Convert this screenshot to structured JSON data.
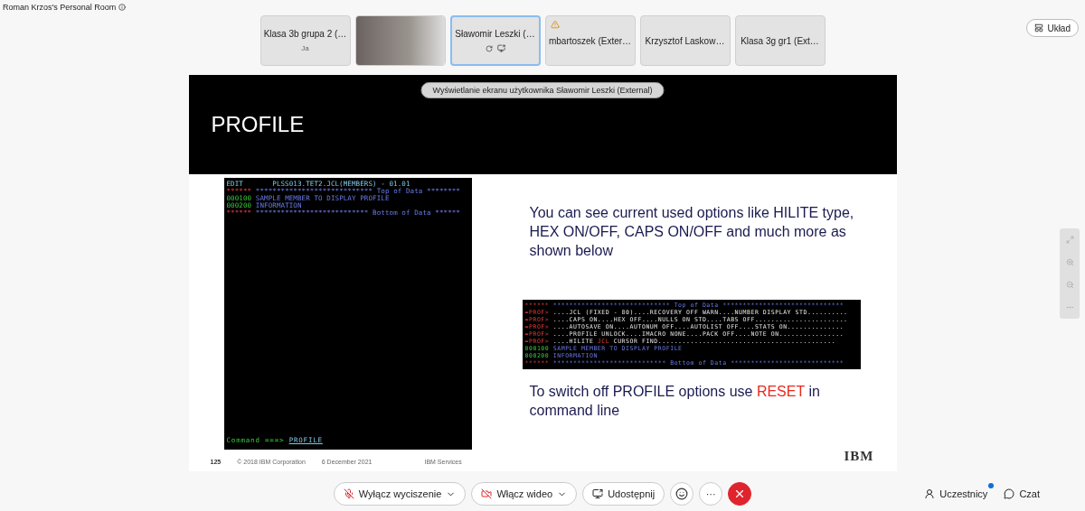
{
  "window": {
    "title": "Roman Krzos's Personal Room"
  },
  "tiles": [
    {
      "kind": "text",
      "name": "Klasa 3b grupa 2 (…",
      "subtitle": "Ja",
      "selected": false
    },
    {
      "kind": "video",
      "selected": false
    },
    {
      "kind": "sharing",
      "name": "Sławomir Leszki (…",
      "selected": true
    },
    {
      "kind": "warning",
      "name": "mbartoszek (Exter…",
      "selected": false
    },
    {
      "kind": "text",
      "name": "Krzysztof Laskow…",
      "selected": false
    },
    {
      "kind": "text",
      "name": "Klasa 3g gr1 (Ext…",
      "selected": false
    }
  ],
  "layout_button": "Układ",
  "banner": "Wyświetlanie ekranu użytkownika Sławomir Leszki (External)",
  "slide": {
    "title": "PROFILE",
    "left_terminal": {
      "lines": [
        [
          {
            "kind": "header",
            "text": "EDIT       PLSS013.TET2.JCL(MEMBERS) - 01.01"
          }
        ],
        [
          {
            "kind": "flag",
            "text": "******"
          },
          {
            "kind": "data",
            "text": " **************************** Top of Data ********"
          }
        ],
        [
          {
            "kind": "seq",
            "text": "000100"
          },
          {
            "kind": "data",
            "text": " SAMPLE MEMBER TO DISPLAY PROFILE"
          }
        ],
        [
          {
            "kind": "seq",
            "text": "000200"
          },
          {
            "kind": "data",
            "text": " INFORMATION"
          }
        ],
        [
          {
            "kind": "flag",
            "text": "******"
          },
          {
            "kind": "data",
            "text": " *************************** Bottom of Data ******"
          }
        ]
      ],
      "command_label": "Command ===>",
      "command": "PROFILE"
    },
    "text_1": "You can see current used options like HILITE type, HEX ON/OFF, CAPS ON/OFF  and much more as shown below",
    "right_terminal": {
      "lines": [
        [
          {
            "kind": "flag",
            "text": "******"
          },
          {
            "kind": "data",
            "text": " ***************************** Top of Data ******************************"
          }
        ],
        [
          {
            "kind": "flag",
            "text": "=PROF>"
          },
          {
            "kind": "info",
            "text": " ....JCL (FIXED - 80)....RECOVERY OFF WARN....NUMBER DISPLAY STD.........."
          }
        ],
        [
          {
            "kind": "flag",
            "text": "=PROF>"
          },
          {
            "kind": "info",
            "text": " ....CAPS ON....HEX OFF....NULLS ON STD....TABS OFF......................."
          }
        ],
        [
          {
            "kind": "flag",
            "text": "=PROF>"
          },
          {
            "kind": "info",
            "text": " ....AUTOSAVE ON....AUTONUM OFF....AUTOLIST OFF....STATS ON.............."
          }
        ],
        [
          {
            "kind": "flag",
            "text": "=PROF>"
          },
          {
            "kind": "info",
            "text": " ....PROFILE UNLOCK....IMACRO NONE....PACK OFF....NOTE ON................"
          }
        ],
        [
          {
            "kind": "flag",
            "text": "=PROF>"
          },
          {
            "kind": "info",
            "text": " ....HILITE "
          },
          {
            "kind": "flag",
            "text": "JCL"
          },
          {
            "kind": "info",
            "text": " CURSOR FIND............................................"
          }
        ],
        [
          {
            "kind": "seq",
            "text": "000100"
          },
          {
            "kind": "data",
            "text": " SAMPLE MEMBER TO DISPLAY PROFILE"
          }
        ],
        [
          {
            "kind": "seq",
            "text": "000200"
          },
          {
            "kind": "data",
            "text": " INFORMATION"
          }
        ],
        [
          {
            "kind": "flag",
            "text": "******"
          },
          {
            "kind": "data",
            "text": " **************************** Bottom of Data ****************************"
          }
        ]
      ]
    },
    "text_2": [
      {
        "kind": "plain",
        "text": "To switch off PROFILE options use "
      },
      {
        "kind": "keyword",
        "text": "RESET"
      },
      {
        "kind": "plain",
        "text": " in command line"
      }
    ],
    "footer": {
      "page": "125",
      "copyright": "© 2018 IBM Corporation",
      "date": "6 December 2021",
      "unit": "IBM Services",
      "logo": "IBM"
    }
  },
  "toolbar": {
    "mute": "Wyłącz wyciszenie",
    "video": "Włącz wideo",
    "share": "Udostępnij",
    "more": "···",
    "participants": "Uczestnicy",
    "participants_badge": true,
    "chat": "Czat"
  }
}
